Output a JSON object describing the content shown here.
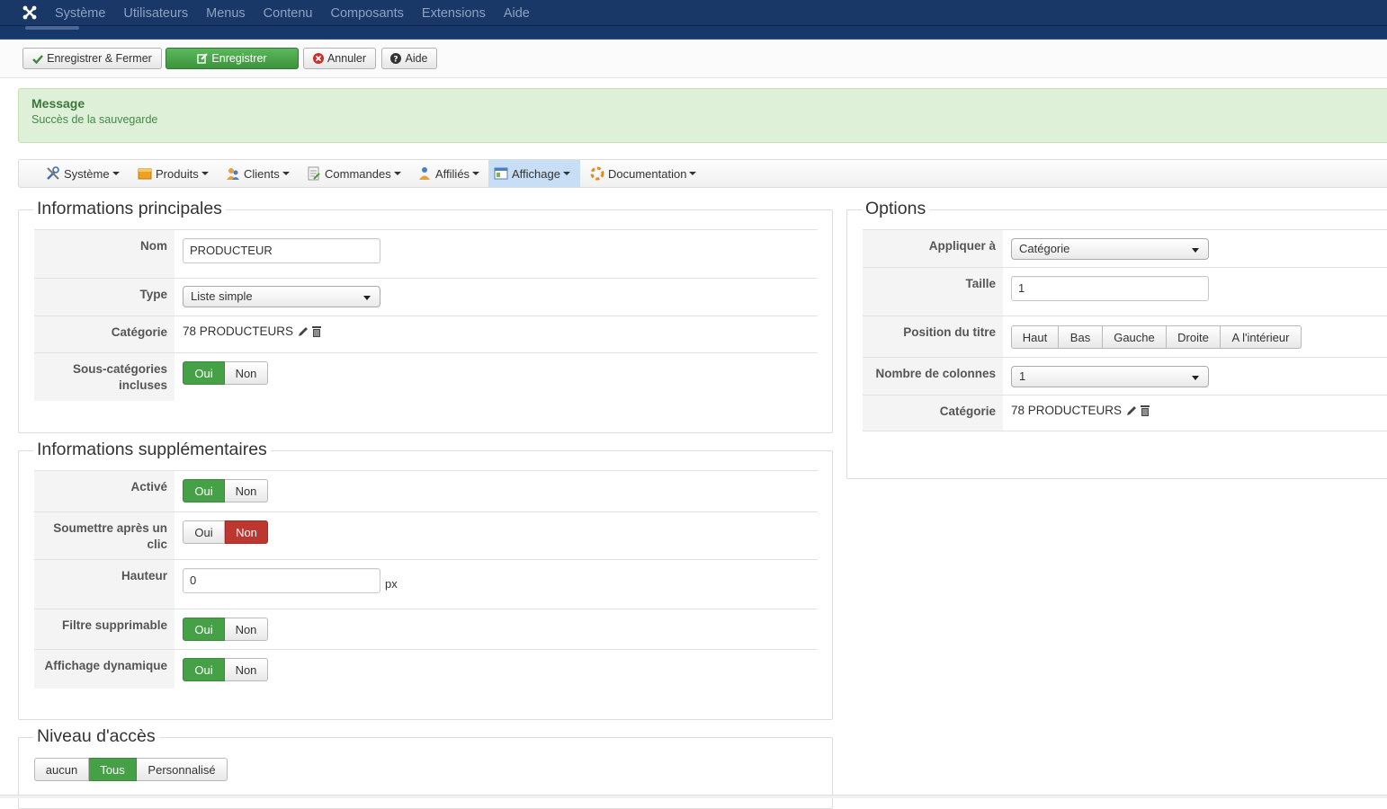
{
  "topnav": {
    "items": [
      "Système",
      "Utilisateurs",
      "Menus",
      "Contenu",
      "Composants",
      "Extensions",
      "Aide"
    ]
  },
  "toolbar": {
    "save_close": "Enregistrer & Fermer",
    "save": "Enregistrer",
    "cancel": "Annuler",
    "help": "Aide"
  },
  "message": {
    "heading": "Message",
    "text": "Succès de la sauvegarde"
  },
  "submenu": {
    "items": [
      "Système",
      "Produits",
      "Clients",
      "Commandes",
      "Affiliés",
      "Affichage",
      "Documentation"
    ],
    "active": "Affichage"
  },
  "main_info": {
    "legend": "Informations principales",
    "nom_label": "Nom",
    "nom_value": "PRODUCTEUR",
    "type_label": "Type",
    "type_value": "Liste simple",
    "categorie_label": "Catégorie",
    "categorie_value": "78 PRODUCTEURS",
    "subcat_label_1": "Sous-catégories",
    "subcat_label_2": "incluses",
    "subcat_yes": "Oui",
    "subcat_no": "Non"
  },
  "extra_info": {
    "legend": "Informations supplémentaires",
    "active_label": "Activé",
    "active_yes": "Oui",
    "active_no": "Non",
    "submit_label_1": "Soumettre après un",
    "submit_label_2": "clic",
    "submit_yes": "Oui",
    "submit_no": "Non",
    "height_label": "Hauteur",
    "height_value": "0",
    "height_unit": "px",
    "deletable_label": "Filtre supprimable",
    "deletable_yes": "Oui",
    "deletable_no": "Non",
    "dynamic_label": "Affichage dynamique",
    "dynamic_yes": "Oui",
    "dynamic_no": "Non"
  },
  "access": {
    "legend": "Niveau d'accès",
    "options": [
      "aucun",
      "Tous",
      "Personnalisé"
    ],
    "selected": "Tous"
  },
  "options": {
    "legend": "Options",
    "apply_label": "Appliquer à",
    "apply_value": "Catégorie",
    "size_label": "Taille",
    "size_value": "1",
    "title_pos_label": "Position du titre",
    "title_pos_options": [
      "Haut",
      "Bas",
      "Gauche",
      "Droite",
      "A l'intérieur"
    ],
    "columns_label": "Nombre de colonnes",
    "columns_value": "1",
    "categorie_label": "Catégorie",
    "categorie_value": "78 PRODUCTEURS"
  },
  "colors": {
    "topbar": "#1a3867",
    "green": "#46a046",
    "red": "#bd362f",
    "message_bg": "#dff0d8"
  }
}
